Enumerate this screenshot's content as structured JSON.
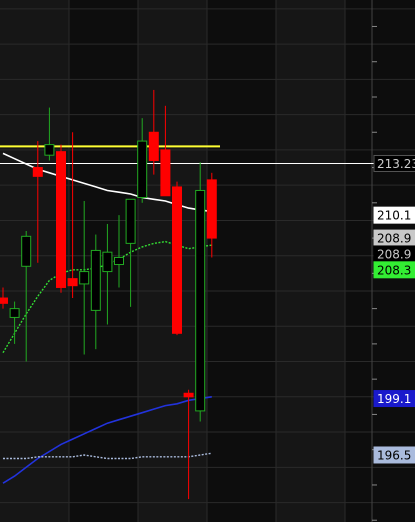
{
  "chart_data": {
    "type": "candlestick",
    "title": "",
    "y_axis_side": "right",
    "ylim": [
      192.9,
      222.5
    ],
    "grid": true,
    "candles": [
      {
        "o": 205.6,
        "h": 206.2,
        "l": 205.0,
        "c": 205.3
      },
      {
        "o": 204.5,
        "h": 205.4,
        "l": 203.0,
        "c": 205.0
      },
      {
        "o": 207.4,
        "h": 209.4,
        "l": 202.0,
        "c": 209.1
      },
      {
        "o": 213.0,
        "h": 214.5,
        "l": 207.6,
        "c": 212.5
      },
      {
        "o": 213.7,
        "h": 216.4,
        "l": 213.4,
        "c": 214.3
      },
      {
        "o": 213.9,
        "h": 214.3,
        "l": 205.9,
        "c": 206.2
      },
      {
        "o": 206.7,
        "h": 215.0,
        "l": 205.6,
        "c": 206.3
      },
      {
        "o": 206.4,
        "h": 211.1,
        "l": 202.4,
        "c": 207.1
      },
      {
        "o": 204.9,
        "h": 209.2,
        "l": 202.7,
        "c": 208.3
      },
      {
        "o": 207.1,
        "h": 209.8,
        "l": 204.1,
        "c": 208.2
      },
      {
        "o": 207.5,
        "h": 210.3,
        "l": 206.2,
        "c": 207.9
      },
      {
        "o": 208.7,
        "h": 210.6,
        "l": 205.1,
        "c": 211.2
      },
      {
        "o": 211.3,
        "h": 215.8,
        "l": 211.0,
        "c": 214.5
      },
      {
        "o": 215.0,
        "h": 217.4,
        "l": 212.6,
        "c": 213.4
      },
      {
        "o": 214.0,
        "h": 216.5,
        "l": 211.4,
        "c": 211.4
      },
      {
        "o": 211.9,
        "h": 212.2,
        "l": 203.5,
        "c": 203.6
      },
      {
        "o": 200.2,
        "h": 200.4,
        "l": 194.2,
        "c": 200.0
      },
      {
        "o": 199.2,
        "h": 213.3,
        "l": 198.6,
        "c": 211.7
      },
      {
        "o": 212.3,
        "h": 212.7,
        "l": 207.9,
        "c": 209.0
      }
    ],
    "horizontal_lines": [
      {
        "value": 214.2,
        "color": "#ffff33"
      },
      {
        "value": 213.23,
        "color": "#ffffff"
      }
    ],
    "series": [
      {
        "color": "#ffffff",
        "style": "solid",
        "values": [
          213.8,
          213.5,
          213.2,
          212.9,
          212.7,
          212.5,
          212.3,
          212.1,
          211.9,
          211.7,
          211.6,
          211.5,
          211.3,
          211.2,
          211.1,
          210.9,
          210.7,
          210.6,
          210.5
        ]
      },
      {
        "color": "#33dd33",
        "style": "dotted",
        "values": [
          202.5,
          203.6,
          204.7,
          205.7,
          206.6,
          207.0,
          207.2,
          207.2,
          207.3,
          207.5,
          207.8,
          208.2,
          208.5,
          208.7,
          208.8,
          208.6,
          208.4,
          208.5,
          208.6
        ]
      },
      {
        "color": "#2233dd",
        "style": "solid",
        "values": [
          195.1,
          195.5,
          196.0,
          196.5,
          196.9,
          197.3,
          197.6,
          197.9,
          198.2,
          198.5,
          198.7,
          198.9,
          199.1,
          199.3,
          199.5,
          199.6,
          199.8,
          199.9,
          200.0
        ]
      },
      {
        "color": "#aabbdd",
        "style": "dotted",
        "values": [
          196.5,
          196.5,
          196.5,
          196.6,
          196.6,
          196.6,
          196.6,
          196.7,
          196.6,
          196.5,
          196.5,
          196.5,
          196.6,
          196.6,
          196.6,
          196.6,
          196.6,
          196.7,
          196.8
        ]
      }
    ],
    "price_labels": [
      {
        "text": "213.23",
        "value": 213.23,
        "bg": "#000000",
        "fg": "#cccccc",
        "border": "#555555"
      },
      {
        "text": "210.1",
        "value": 210.3,
        "bg": "#ffffff",
        "fg": "#000000",
        "border": "#ffffff"
      },
      {
        "text": "208.9",
        "value": 209.0,
        "bg": "#c8c8c8",
        "fg": "#000000",
        "border": "#c8c8c8"
      },
      {
        "text": "208.9",
        "value": 208.1,
        "bg": "#000000",
        "fg": "#c8c8c8",
        "border": "#000000"
      },
      {
        "text": "208.3",
        "value": 207.2,
        "bg": "#33ee33",
        "fg": "#000000",
        "border": "#33ee33"
      },
      {
        "text": "199.1",
        "value": 199.9,
        "bg": "#1a1acc",
        "fg": "#ffffff",
        "border": "#1a1acc"
      },
      {
        "text": "196.5",
        "value": 196.7,
        "bg": "#aabbdd",
        "fg": "#000000",
        "border": "#aabbdd"
      }
    ],
    "colors": {
      "up_candle": "#22aa22",
      "down_candle": "#ff0000",
      "wick": "#ff0000",
      "grid": "#2a2a2a",
      "background": "#0d0d0d"
    }
  }
}
